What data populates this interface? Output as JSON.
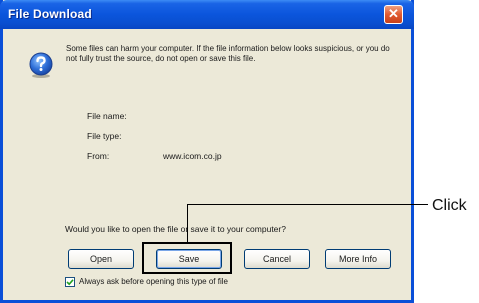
{
  "dialog": {
    "title": "File Download",
    "close_symbol": "✕",
    "icon": "help-question-icon",
    "warning": "Some files can harm your computer. If the file information below looks suspicious, or you do not fully trust the source, do not open or save this file.",
    "file_name_label": "File name:",
    "file_name_value": "",
    "file_type_label": "File type:",
    "file_type_value": "",
    "from_label": "From:",
    "from_value": "www.icom.co.jp",
    "question": "Would you like to open the file or save it to your computer?",
    "buttons": {
      "open": "Open",
      "save": "Save",
      "cancel": "Cancel",
      "more_info": "More Info"
    },
    "always_ask_checked": true,
    "always_ask_label": "Always ask before opening this type of file"
  },
  "annotation": {
    "callout_label": "Click"
  },
  "colors": {
    "titlebar": "#0a4fd0",
    "dialog_bg": "#ece9d8",
    "button_border": "#003c74",
    "close_button": "#e05a30"
  }
}
